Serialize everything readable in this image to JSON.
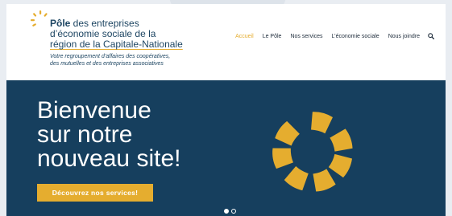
{
  "logo": {
    "name_bold": "Pôle",
    "line1_rest": " des entreprises",
    "line2": "d’économie sociale de la",
    "line3": "région de la Capitale-Nationale",
    "tagline1": "Votre regroupement d’affaires des coopératives,",
    "tagline2": "des mutuelles et des entreprises associatives"
  },
  "nav": {
    "items": [
      "Accueil",
      "Le Pôle",
      "Nos services",
      "L’économie sociale",
      "Nous joindre"
    ],
    "active_index": 0,
    "search_icon": "search-icon"
  },
  "hero": {
    "title_lines": [
      "Bienvenue",
      "sur notre",
      "nouveau site!"
    ],
    "cta_label": "Découvrez nos services!",
    "slider_total": 2,
    "slider_active": 1
  },
  "colors": {
    "brand_navy": "#163f5e",
    "accent_gold": "#e5ad2f",
    "text_dark": "#1d4562",
    "white": "#ffffff"
  }
}
